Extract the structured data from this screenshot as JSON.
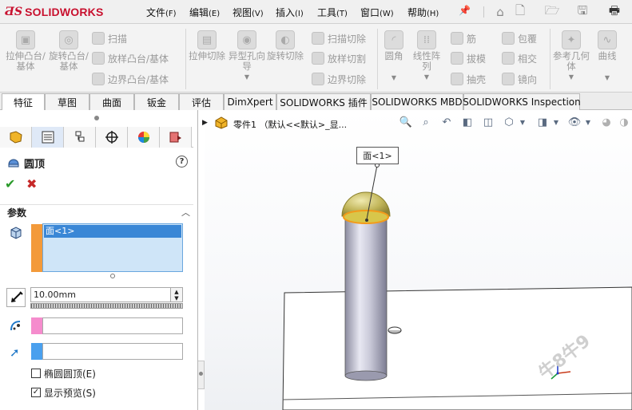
{
  "app": {
    "name": "SOLIDWORKS",
    "brand_color": "#c8102e"
  },
  "menu": [
    {
      "label": "文件",
      "acc": "(F)"
    },
    {
      "label": "编辑",
      "acc": "(E)"
    },
    {
      "label": "视图",
      "acc": "(V)"
    },
    {
      "label": "插入",
      "acc": "(I)"
    },
    {
      "label": "工具",
      "acc": "(T)"
    },
    {
      "label": "窗口",
      "acc": "(W)"
    },
    {
      "label": "帮助",
      "acc": "(H)"
    }
  ],
  "ribbon": {
    "extrude_boss": "拉伸凸台/基体",
    "revolve_boss": "旋转凸台/基体",
    "sweep": "扫描",
    "loft_boss": "放样凸台/基体",
    "boundary_boss": "边界凸台/基体",
    "extrude_cut": "拉伸切除",
    "hole_wizard": "异型孔向导",
    "revolve_cut": "旋转切除",
    "sweep_cut": "扫描切除",
    "loft_cut": "放样切割",
    "boundary_cut": "边界切除",
    "fillet": "圆角",
    "linear_pattern": "线性阵列",
    "rib": "筋",
    "draft": "拔模",
    "shell": "抽壳",
    "wrap": "包覆",
    "intersect": "相交",
    "mirror": "镜向",
    "ref_geometry": "参考几何体",
    "curves": "曲线"
  },
  "tabs": [
    "特征",
    "草图",
    "曲面",
    "钣金",
    "评估",
    "DimXpert",
    "SOLIDWORKS 插件",
    "SOLIDWORKS MBD",
    "SOLIDWORKS Inspection"
  ],
  "property_manager": {
    "title": "圆顶",
    "section_params": "参数",
    "selected_face": "面<1>",
    "distance": "10.00mm",
    "elliptical_dome": "椭圆圆顶(E)",
    "show_preview": "显示预览(S)",
    "elliptical_checked": false,
    "preview_checked": true,
    "face_color": "#f39a3a",
    "point_color": "#f58ccd",
    "direction_color": "#4aa0ee"
  },
  "viewport": {
    "tree_label": "零件1 （默认<<默认>_显...",
    "callout": "面<1>",
    "watermark": "牛8牛9"
  }
}
